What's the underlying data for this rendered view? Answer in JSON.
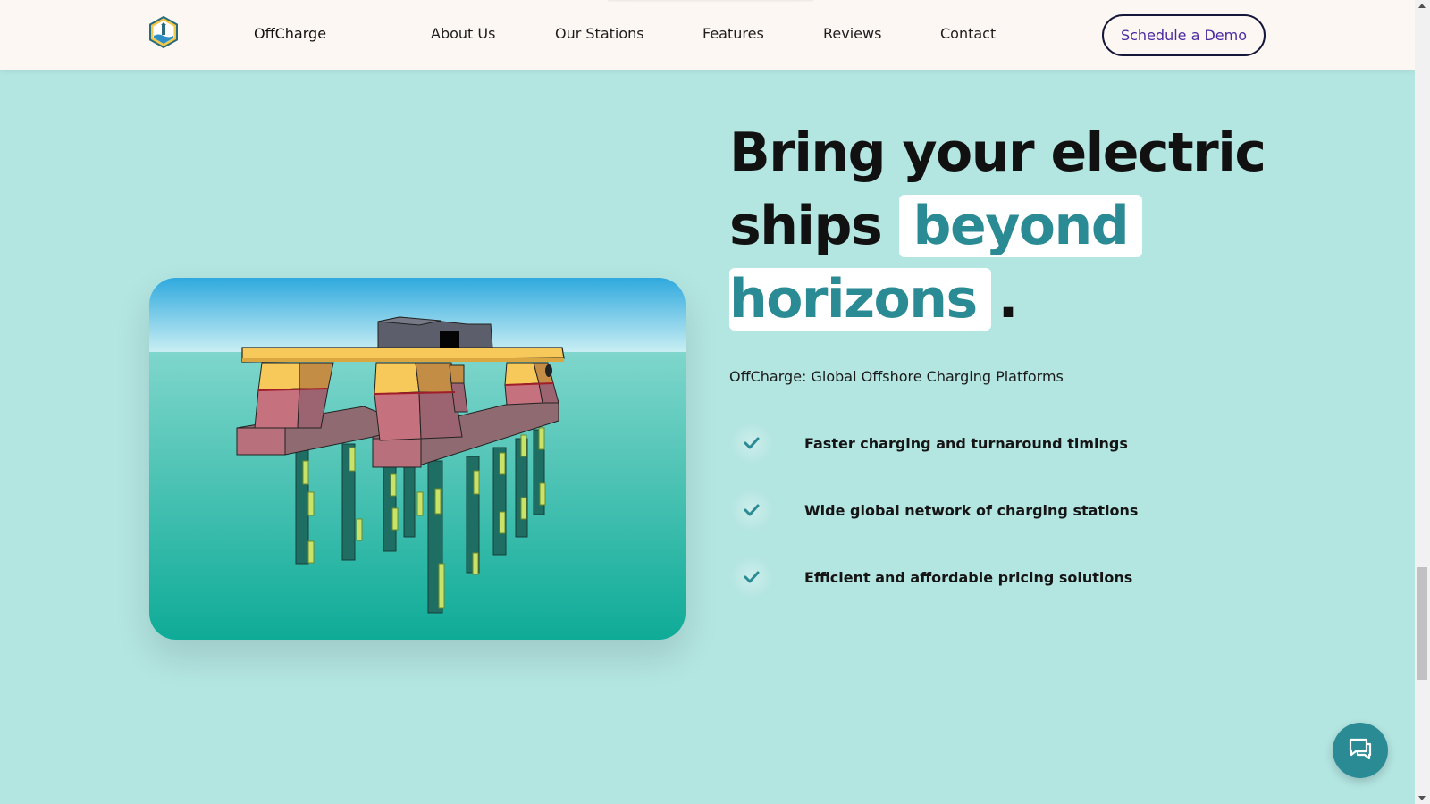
{
  "nav": {
    "brand": "OffCharge",
    "links": [
      "About Us",
      "Our Stations",
      "Features",
      "Reviews",
      "Contact"
    ],
    "cta": "Schedule a Demo"
  },
  "hero": {
    "headline_line1": "Bring your electric",
    "headline_line2_plain": "ships",
    "headline_highlight1": "beyond",
    "headline_highlight2": "horizons",
    "headline_end": ".",
    "subtitle": "OffCharge: Global Offshore Charging Platforms",
    "features": [
      "Faster charging and turnaround timings",
      "Wide global network of charging stations",
      "Efficient and affordable pricing solutions"
    ]
  },
  "colors": {
    "accent": "#2b8b94",
    "background": "#b3e5e1",
    "nav_bg": "#fdf7f4",
    "cta_text": "#4b2aa0"
  },
  "icons": {
    "logo": "hexagon-lighthouse-logo",
    "check": "check-icon",
    "chat": "chat-icon"
  }
}
